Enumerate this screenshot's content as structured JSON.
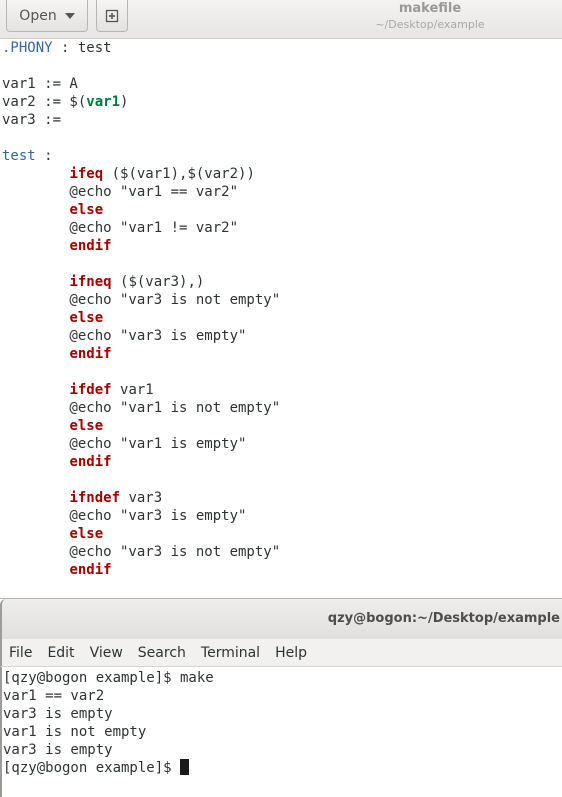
{
  "editor": {
    "open_label": "Open",
    "title": "makefile",
    "subtitle": "~/Desktop/example",
    "code": {
      "l1": [
        ".PHONY",
        " : test"
      ],
      "l3": "var1 := A",
      "l4": [
        "var2 := $(",
        "var1",
        ")"
      ],
      "l5": "var3 :=",
      "l7": [
        "test",
        " :"
      ],
      "l8": [
        "        ",
        "ifeq",
        " ($(var1),$(var2))"
      ],
      "l9": "        @echo \"var1 == var2\"",
      "l10": [
        "        ",
        "else"
      ],
      "l11": "        @echo \"var1 != var2\"",
      "l12": [
        "        ",
        "endif"
      ],
      "l14": [
        "        ",
        "ifneq",
        " ($(var3),)"
      ],
      "l15": "        @echo \"var3 is not empty\"",
      "l16": [
        "        ",
        "else"
      ],
      "l17": "        @echo \"var3 is empty\"",
      "l18": [
        "        ",
        "endif"
      ],
      "l20": [
        "        ",
        "ifdef",
        " var1"
      ],
      "l21": "        @echo \"var1 is not empty\"",
      "l22": [
        "        ",
        "else"
      ],
      "l23": "        @echo \"var1 is empty\"",
      "l24": [
        "        ",
        "endif"
      ],
      "l26": [
        "        ",
        "ifndef",
        " var3"
      ],
      "l27": "        @echo \"var3 is empty\"",
      "l28": [
        "        ",
        "else"
      ],
      "l29": "        @echo \"var3 is not empty\"",
      "l30": [
        "        ",
        "endif"
      ]
    }
  },
  "terminal": {
    "title": "qzy@bogon:~/Desktop/example",
    "menu": [
      "File",
      "Edit",
      "View",
      "Search",
      "Terminal",
      "Help"
    ],
    "lines": [
      "[qzy@bogon example]$ make",
      "var1 == var2",
      "var3 is empty",
      "var1 is not empty",
      "var3 is empty",
      "[qzy@bogon example]$ "
    ]
  },
  "icons": {
    "open_dropdown": "chevron-down-icon",
    "new_tab": "new-document-icon"
  }
}
